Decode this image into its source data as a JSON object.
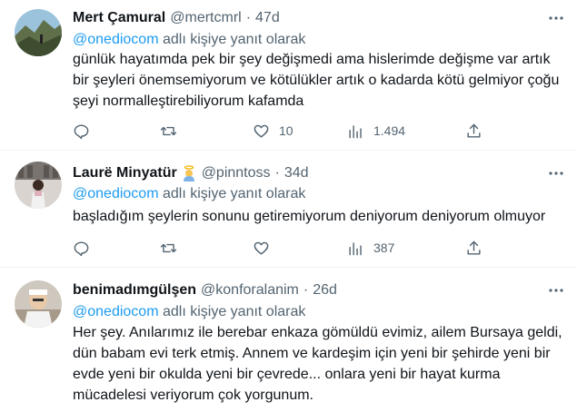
{
  "reply_prefix": "adlı kişiye yanıt olarak",
  "tweets": [
    {
      "name": "Mert Çamural",
      "handle": "@mertcmrl",
      "dot": "·",
      "time": "47d",
      "mention": "@onediocom",
      "body": "günlük hayatımda pek bir şey değişmedi ama hislerimde değişme var artık bir şeyleri önemsemiyorum ve kötülükler artık o kadarda kötü gelmiyor çoğu şeyi normalleştirebiliyorum kafamda",
      "replies": "",
      "retweets": "",
      "likes": "10",
      "views": "1.494"
    },
    {
      "name": "Laurë Minyatür",
      "handle": "@pinntoss",
      "dot": "·",
      "time": "34d",
      "mention": "@onediocom",
      "body": "başladığım şeylerin sonunu getiremiyorum deniyorum deniyorum olmuyor",
      "replies": "",
      "retweets": "",
      "likes": "",
      "views": "387"
    },
    {
      "name": "benimadımgülşen",
      "handle": "@konforalanim",
      "dot": "·",
      "time": "26d",
      "mention": "@onediocom",
      "body": "Her şey. Anılarımız ile berebar enkaza gömüldü evimiz, ailem Bursaya geldi, dün babam evi terk etmiş. Annem ve kardeşim için yeni bir şehirde yeni bir evde yeni bir okulda yeni bir çevrede... onlara yeni bir hayat kurma mücadelesi veriyorum çok yorgunum."
    }
  ],
  "colors": {
    "accent": "#1d9bf0",
    "muted": "#536471",
    "text": "#0f1419",
    "divider": "#eff3f4"
  },
  "icons": [
    "reply-icon",
    "retweet-icon",
    "like-icon",
    "views-icon",
    "share-icon",
    "more-icon",
    "angel-emoji-icon"
  ]
}
